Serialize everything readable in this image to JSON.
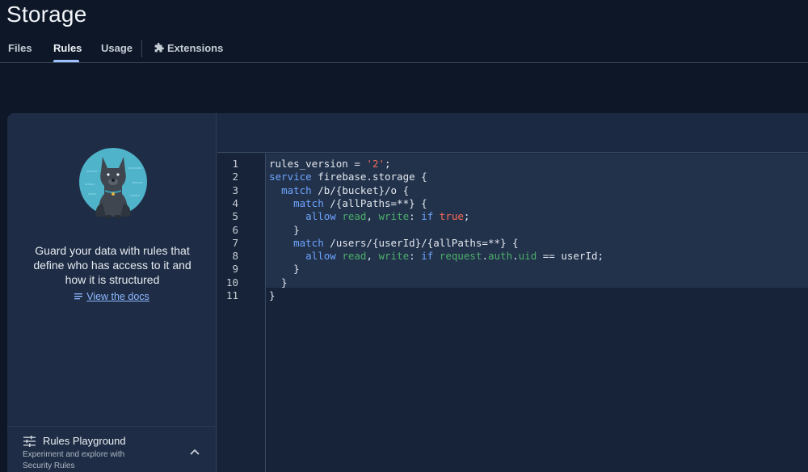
{
  "page": {
    "title": "Storage"
  },
  "tabs": [
    {
      "label": "Files"
    },
    {
      "label": "Rules"
    },
    {
      "label": "Usage"
    },
    {
      "label": "Extensions"
    }
  ],
  "side": {
    "description": "Guard your data with rules that define who has access to it and how it is structured",
    "docs_link": "View the docs",
    "playground": {
      "title": "Rules Playground",
      "subtitle": "Experiment and explore with Security Rules"
    }
  },
  "editor": {
    "lines": [
      {
        "n": "1",
        "tokens": [
          [
            "",
            "rules_version = "
          ],
          [
            "str",
            "'2'"
          ],
          [
            "",
            ";"
          ]
        ]
      },
      {
        "n": "2",
        "tokens": [
          [
            "kw",
            "service"
          ],
          [
            "",
            " firebase.storage {"
          ]
        ]
      },
      {
        "n": "3",
        "tokens": [
          [
            "",
            "  "
          ],
          [
            "kw",
            "match"
          ],
          [
            "",
            " /b/{bucket}/o {"
          ]
        ]
      },
      {
        "n": "4",
        "tokens": [
          [
            "",
            "    "
          ],
          [
            "kw",
            "match"
          ],
          [
            "",
            " /{allPaths=**} {"
          ]
        ]
      },
      {
        "n": "5",
        "tokens": [
          [
            "",
            "      "
          ],
          [
            "kw",
            "allow"
          ],
          [
            "",
            " "
          ],
          [
            "grn",
            "read"
          ],
          [
            "",
            ", "
          ],
          [
            "grn",
            "write"
          ],
          [
            "",
            ": "
          ],
          [
            "kw",
            "if"
          ],
          [
            "",
            " "
          ],
          [
            "red",
            "true"
          ],
          [
            "",
            ";"
          ]
        ]
      },
      {
        "n": "6",
        "tokens": [
          [
            "",
            "    }"
          ]
        ]
      },
      {
        "n": "7",
        "tokens": [
          [
            "",
            "    "
          ],
          [
            "kw",
            "match"
          ],
          [
            "",
            " /users/{userId}/{allPaths=**} {"
          ]
        ]
      },
      {
        "n": "8",
        "tokens": [
          [
            "",
            "      "
          ],
          [
            "kw",
            "allow"
          ],
          [
            "",
            " "
          ],
          [
            "grn",
            "read"
          ],
          [
            "",
            ", "
          ],
          [
            "grn",
            "write"
          ],
          [
            "",
            ": "
          ],
          [
            "kw",
            "if"
          ],
          [
            "",
            " "
          ],
          [
            "grn",
            "request"
          ],
          [
            "",
            "."
          ],
          [
            "grn",
            "auth"
          ],
          [
            "",
            "."
          ],
          [
            "grn",
            "uid"
          ],
          [
            "",
            " == userId;"
          ]
        ]
      },
      {
        "n": "9",
        "tokens": [
          [
            "",
            "    }"
          ]
        ]
      },
      {
        "n": "10",
        "tokens": [
          [
            "",
            "  }"
          ]
        ]
      },
      {
        "n": "11",
        "tokens": [
          [
            "",
            "}"
          ]
        ]
      }
    ]
  },
  "icons": {
    "extensions": "puzzle-icon",
    "docs": "notes-icon",
    "playground": "tune-icon",
    "collapse": "chevron-up-icon"
  }
}
